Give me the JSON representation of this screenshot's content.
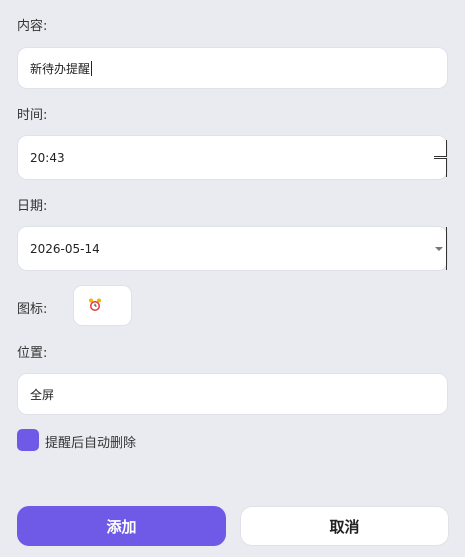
{
  "form": {
    "content": {
      "label": "内容:",
      "value": "新待办提醒"
    },
    "time": {
      "label": "时间:",
      "value": "20:43"
    },
    "date": {
      "label": "日期:",
      "value": "2026-05-14"
    },
    "icon": {
      "label": "图标:",
      "selected_icon": "alarm-clock-icon"
    },
    "position": {
      "label": "位置:",
      "value": "全屏"
    },
    "auto_delete": {
      "label": "提醒后自动删除",
      "checked": true
    }
  },
  "actions": {
    "add_label": "添加",
    "cancel_label": "取消"
  },
  "colors": {
    "accent": "#6e5ae6",
    "background": "#eaebf1"
  }
}
